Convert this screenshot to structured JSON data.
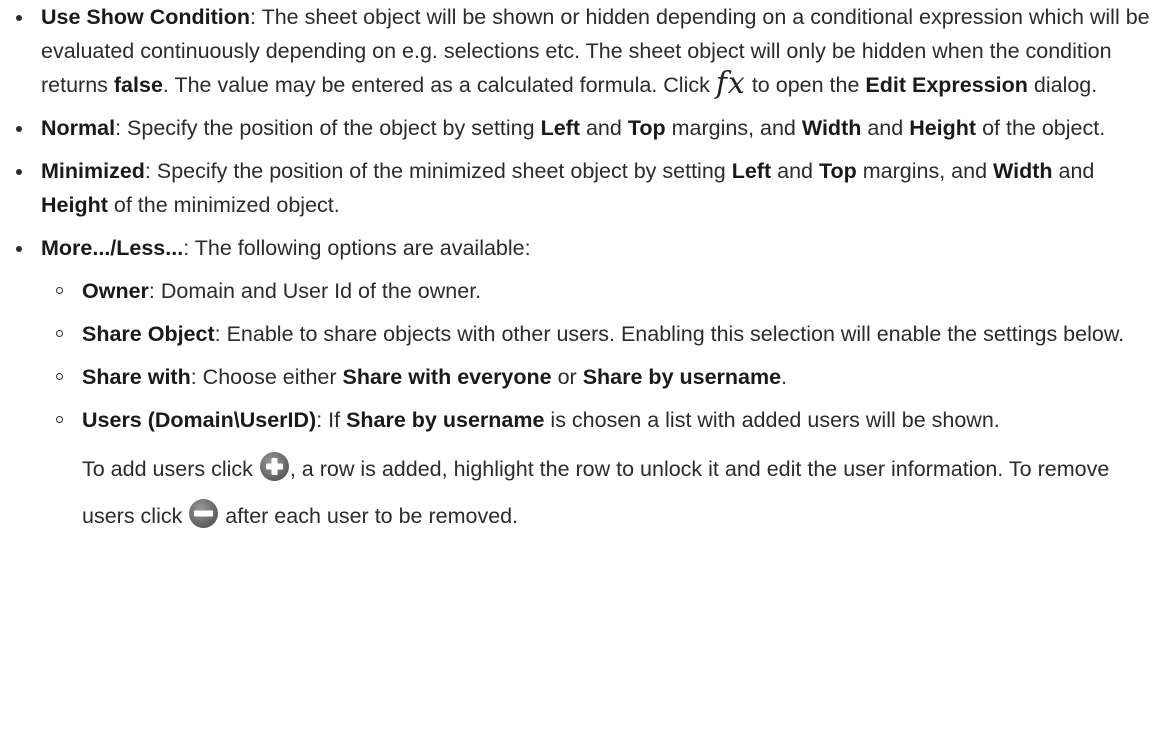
{
  "items": [
    {
      "term": "Use Show Condition",
      "desc1": ": The sheet object will be shown or hidden depending on a conditional expression which will be evaluated continuously depending on e.g. selections etc. The sheet object will only be hidden when the condition returns ",
      "bold1": "false",
      "desc2": ". The value may be entered as a calculated formula. Click ",
      "fx_label": "fx",
      "desc3": " to open the ",
      "bold2": "Edit Expression",
      "desc4": " dialog."
    },
    {
      "term": "Normal",
      "desc1": ": Specify the position of the object by setting ",
      "b1": "Left",
      "t1": " and ",
      "b2": "Top",
      "t2": " margins, and ",
      "b3": "Width",
      "t3": " and ",
      "b4": "Height",
      "t4": " of the object."
    },
    {
      "term": "Minimized",
      "desc1": ": Specify the position of the minimized sheet object by setting ",
      "b1": "Left",
      "t1": " and ",
      "b2": "Top",
      "t2": " margins, and ",
      "b3": "Width",
      "t3": " and ",
      "b4": "Height",
      "t4": " of the minimized object."
    },
    {
      "term": "More.../Less...",
      "desc1": ": The following options are available:"
    }
  ],
  "subitems": [
    {
      "term": "Owner",
      "desc1": ": Domain and User Id of the owner."
    },
    {
      "term": "Share Object",
      "desc1": ": Enable to share objects with other users. Enabling this selection will enable the settings below."
    },
    {
      "term": "Share with",
      "desc1": ": Choose either ",
      "b1": "Share with everyone",
      "t1": " or ",
      "b2": "Share by username",
      "t2": "."
    },
    {
      "term": "Users (Domain\\UserID)",
      "desc1": ": If ",
      "b1": "Share by username",
      "t1": " is chosen a list with added users will be shown.",
      "para_a": "To add users click ",
      "para_b": ", a row is added, highlight the row to unlock it and edit the user information. To remove users click ",
      "para_c": " after each user to be removed."
    }
  ],
  "icons": {
    "add": "add-user-plus-icon",
    "remove": "remove-user-minus-icon",
    "fx": "fx-expression-icon"
  },
  "colors": {
    "text": "#2b2b2b",
    "icon_fill": "#6e6e6e"
  }
}
